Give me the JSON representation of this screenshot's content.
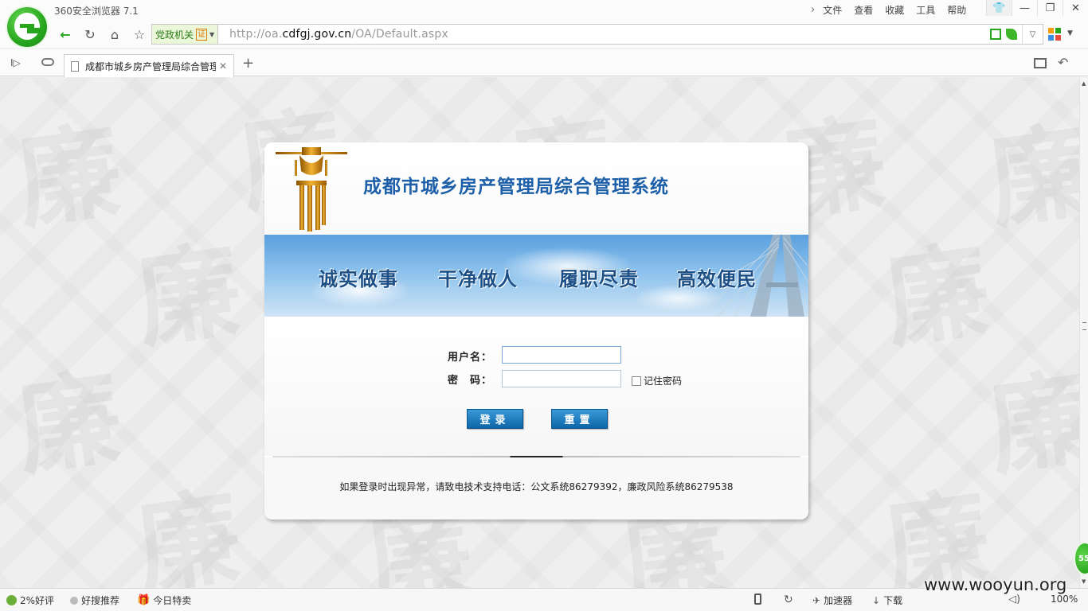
{
  "browser": {
    "app_name": "360安全浏览器 7.1",
    "menu": [
      "文件",
      "查看",
      "收藏",
      "工具",
      "帮助"
    ],
    "cert_label": "党政机关",
    "cert_badge": "证",
    "url_prefix": "http://oa.",
    "url_domain": "cdfgj.gov.cn",
    "url_path": "/OA/Default.aspx",
    "tab_title": "成都市城乡房产管理局综合管理系统",
    "colors": {
      "brand_green": "#27a51d",
      "title_blue": "#1d5fa8",
      "button_blue": "#0e66a8"
    }
  },
  "page": {
    "system_title": "成都市城乡房产管理局综合管理系统",
    "mottos": [
      "诚实做事",
      "干净做人",
      "履职尽责",
      "高效便民"
    ],
    "watermark_char": "廉",
    "form": {
      "username_label": "用户名：",
      "password_label": "密　码：",
      "username_value": "",
      "password_value": "",
      "remember_label": "记住密码",
      "remember_checked": false,
      "login_button": "登录",
      "reset_button": "重置"
    },
    "support_text": "如果登录时出现异常，请致电技术支持电话：公文系统86279392，廉政风险系统86279538"
  },
  "statusbar": {
    "rating": "2%好评",
    "recommend": "好搜推荐",
    "daily_deal": "今日特卖",
    "accelerator": "加速器",
    "download": "下载",
    "zoom": "100%",
    "speed_badge": "55",
    "site_watermark": "www.wooyun.org"
  }
}
